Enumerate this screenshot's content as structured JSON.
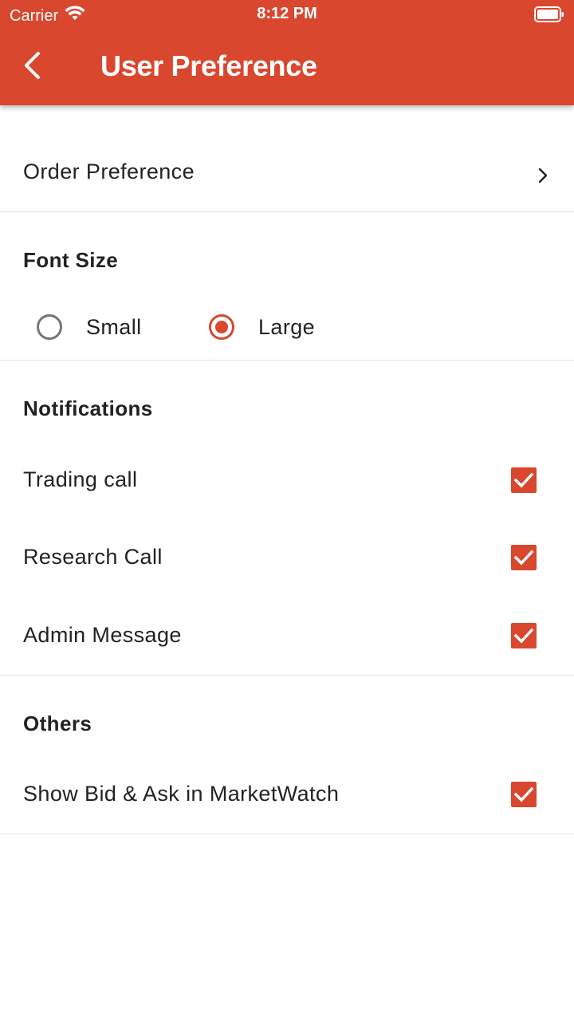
{
  "status_bar": {
    "carrier": "Carrier",
    "time": "8:12 PM"
  },
  "header": {
    "title": "User Preference",
    "back_icon": "chevron-left-icon"
  },
  "order_preference": {
    "label": "Order Preference",
    "icon": "chevron-right-icon"
  },
  "font_size": {
    "title": "Font Size",
    "options": [
      {
        "label": "Small",
        "selected": false
      },
      {
        "label": "Large",
        "selected": true
      }
    ]
  },
  "notifications": {
    "title": "Notifications",
    "items": [
      {
        "label": "Trading call",
        "checked": true
      },
      {
        "label": "Research Call",
        "checked": true
      },
      {
        "label": "Admin Message",
        "checked": true
      }
    ]
  },
  "others": {
    "title": "Others",
    "items": [
      {
        "label": "Show Bid & Ask in MarketWatch",
        "checked": true
      }
    ]
  },
  "colors": {
    "accent": "#d9472f",
    "text": "#222222",
    "divider": "#e6e6e6"
  }
}
